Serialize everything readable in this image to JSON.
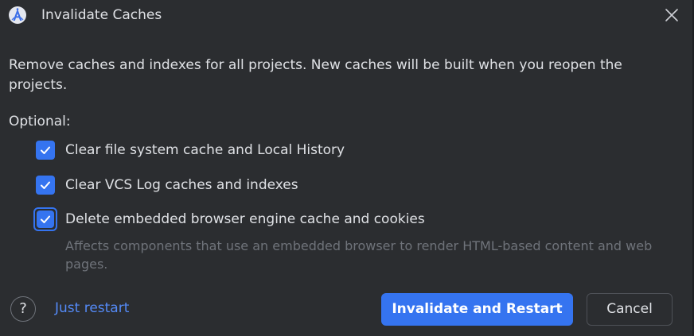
{
  "dialog": {
    "title": "Invalidate Caches",
    "description": "Remove caches and indexes for all projects. New caches will be built when you reopen the projects.",
    "optional_label": "Optional:",
    "options": [
      {
        "label": "Clear file system cache and Local History",
        "checked": true
      },
      {
        "label": "Clear VCS Log caches and indexes",
        "checked": true
      },
      {
        "label": "Delete embedded browser engine cache and cookies",
        "checked": true
      }
    ],
    "hint": "Affects components that use an embedded browser to render HTML-based content and web pages.",
    "help_label": "?",
    "just_restart_label": "Just restart",
    "primary_button_label": "Invalidate and Restart",
    "cancel_button_label": "Cancel"
  },
  "colors": {
    "background": "#2b2d30",
    "text": "#dfe1e5",
    "muted_text": "#6f737a",
    "accent": "#3574f0",
    "link": "#548af7",
    "button_border": "#4e5157"
  },
  "icons": {
    "app": "android-studio-icon",
    "close": "close-icon",
    "checkbox_check": "checkmark-icon"
  }
}
